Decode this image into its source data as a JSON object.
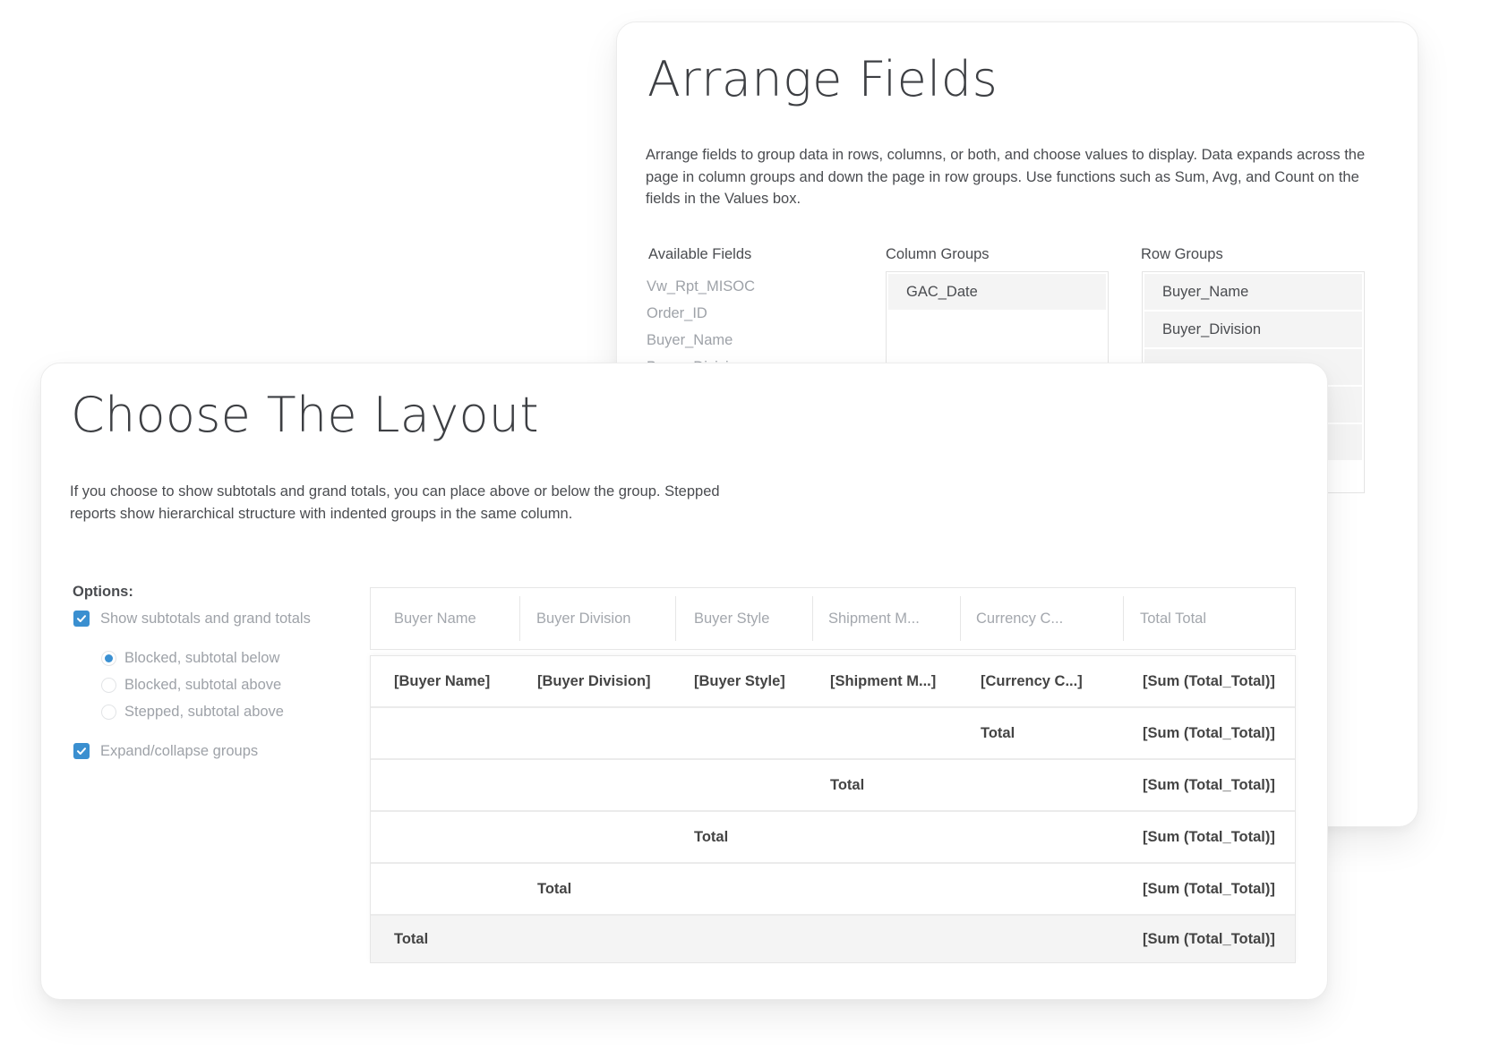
{
  "arrange_fields": {
    "title": "Arrange Fields",
    "description": "Arrange fields to group data in rows, columns, or both, and choose values to display. Data expands across the page in column groups and down the page in row groups. Use functions such as Sum, Avg, and Count on the fields in the Values box.",
    "available_fields": {
      "label": "Available Fields",
      "items": [
        "Vw_Rpt_MISOC",
        "Order_ID",
        "Buyer_Name",
        "Buyer_Division"
      ]
    },
    "column_groups": {
      "label": "Column Groups",
      "items": [
        "GAC_Date"
      ]
    },
    "row_groups": {
      "label": "Row Groups",
      "items": [
        "Buyer_Name",
        "Buyer_Division"
      ]
    }
  },
  "choose_layout": {
    "title": "Choose The Layout",
    "description": "If you choose to show subtotals and grand totals, you can place above or below the group. Stepped\n reports show hierarchical structure with indented groups in the same column.",
    "options": {
      "label": "Options:",
      "show_subtotals": {
        "label": "Show subtotals and grand totals",
        "checked": true
      },
      "placement": [
        {
          "label": "Blocked, subtotal below",
          "selected": true
        },
        {
          "label": "Blocked, subtotal above",
          "selected": false
        },
        {
          "label": "Stepped, subtotal above",
          "selected": false
        }
      ],
      "expand_collapse": {
        "label": "Expand/collapse groups",
        "checked": true
      }
    },
    "preview_table": {
      "columns": [
        "Buyer Name",
        "Buyer Division",
        "Buyer Style",
        "Shipment M...",
        "Currency C...",
        "Total Total"
      ],
      "rows": [
        [
          "[Buyer Name]",
          "[Buyer Division]",
          "[Buyer Style]",
          "[Shipment M...]",
          "[Currency C...]",
          "[Sum (Total_Total)]"
        ],
        [
          "",
          "",
          "",
          "",
          "Total",
          "[Sum (Total_Total)]"
        ],
        [
          "",
          "",
          "",
          "Total",
          "",
          "[Sum (Total_Total)]"
        ],
        [
          "",
          "",
          "Total",
          "",
          "",
          "[Sum (Total_Total)]"
        ],
        [
          "",
          "Total",
          "",
          "",
          "",
          "[Sum (Total_Total)]"
        ],
        [
          "Total",
          "",
          "",
          "",
          "",
          "[Sum (Total_Total)]"
        ]
      ]
    }
  },
  "colors": {
    "accent": "#3a8fd0",
    "grand_total_row_bg": "#f4f4f4",
    "group_item_bg": "#f4f4f4"
  }
}
